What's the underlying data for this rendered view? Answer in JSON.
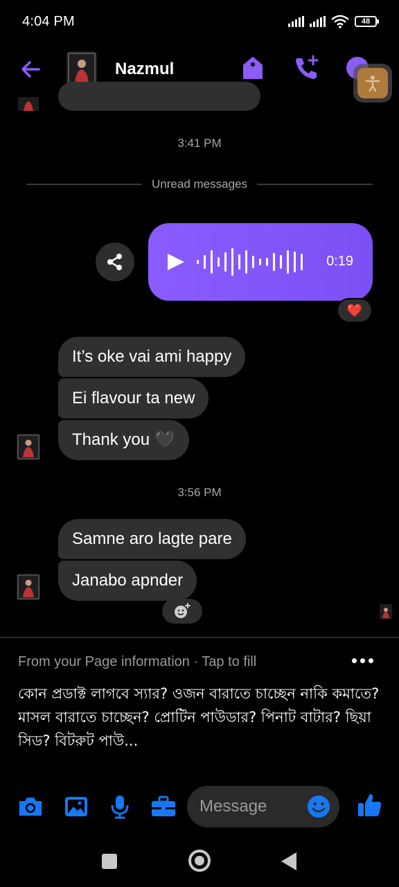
{
  "status_bar": {
    "time": "4:04 PM",
    "battery": "48"
  },
  "header": {
    "contact_name": "Nazmul"
  },
  "conversation": {
    "timestamp_1": "3:41 PM",
    "unread_label": "Unread messages",
    "voice_message": {
      "duration": "0:19",
      "reaction": "❤️"
    },
    "group_1": [
      {
        "text": "It’s oke vai ami happy"
      },
      {
        "text": "Ei flavour ta new"
      },
      {
        "text": "Thank you 🖤"
      }
    ],
    "timestamp_2": "3:56 PM",
    "group_2": [
      {
        "text": "Samne aro lagte pare"
      },
      {
        "text": "Janabo apnder"
      }
    ]
  },
  "suggestion": {
    "heading": "From your Page information · Tap to fill",
    "text": "কোন প্রডাক্ট লাগবে স্যার? ওজন বারাতে চাচ্ছেন নাকি কমাতে? মাসল বারাতে চাচ্ছেন? প্রোটিন পাউডার? পিনাট বাটার? ছিয়া সিড? বিটরুট পাউ..."
  },
  "composer": {
    "placeholder": "Message"
  },
  "colors": {
    "accent": "#8b5cf6",
    "icon_blue": "#1877f2",
    "bubble": "#303030"
  }
}
